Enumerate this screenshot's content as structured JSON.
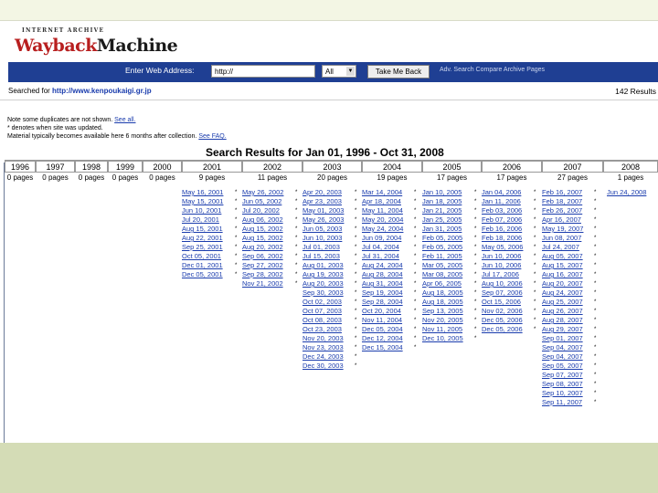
{
  "logo": {
    "top": "INTERNET ARCHIVE",
    "brand_a": "Wayback",
    "brand_b": "Machine"
  },
  "nav": {
    "enter_label": "Enter Web Address:",
    "url_value": "http://",
    "select_value": "All",
    "button_label": "Take Me Back",
    "links": "Adv. Search   Compare Archive Pages"
  },
  "searched": {
    "prefix": "Searched for",
    "url": "http://www.kenpoukaigi.gr.jp"
  },
  "results_count": "142 Results",
  "notes": [
    "Note some duplicates are not shown.",
    "See all.",
    "* denotes when site was updated.",
    "Material typically becomes available here 6 months after collection.",
    "See FAQ."
  ],
  "title": "Search Results for Jan 01, 1996 - Oct 31, 2008",
  "columns": [
    {
      "year": "1996",
      "pages": "0 pages",
      "dates": []
    },
    {
      "year": "1997",
      "pages": "0 pages",
      "dates": []
    },
    {
      "year": "1998",
      "pages": "0 pages",
      "dates": []
    },
    {
      "year": "1999",
      "pages": "0 pages",
      "dates": []
    },
    {
      "year": "2000",
      "pages": "0 pages",
      "dates": []
    },
    {
      "year": "2001",
      "pages": "9 pages",
      "dates": [
        "May 16, 2001",
        "May 15, 2001",
        "Jun 10, 2001",
        "Jul 20, 2001",
        "Aug 15, 2001",
        "Aug 22, 2001",
        "Sep 25, 2001",
        "Oct 05, 2001",
        "Dec 01, 2001",
        "Dec 05, 2001"
      ]
    },
    {
      "year": "2002",
      "pages": "11 pages",
      "dates": [
        "May 26, 2002",
        "Jun 05, 2002",
        "Jul 20, 2002",
        "Aug 06, 2002",
        "Aug 15, 2002",
        "Aug 15, 2002",
        "Aug 20, 2002",
        "Sep 06, 2002",
        "Sep 27, 2002",
        "Sep 28, 2002",
        "Nov 21, 2002"
      ]
    },
    {
      "year": "2003",
      "pages": "20 pages",
      "dates": [
        "Apr 20, 2003",
        "Apr 23, 2003",
        "May 01, 2003",
        "May 26, 2003",
        "Jun 05, 2003",
        "Jun 10, 2003",
        "Jul 01, 2003",
        "Jul 15, 2003",
        "Aug 01, 2003",
        "Aug 19, 2003",
        "Aug 20, 2003",
        "Sep 30, 2003",
        "Oct 02, 2003",
        "Oct 07, 2003",
        "Oct 08, 2003",
        "Oct 23, 2003",
        "Nov 20, 2003",
        "Nov 23, 2003",
        "Dec 24, 2003",
        "Dec 30, 2003"
      ]
    },
    {
      "year": "2004",
      "pages": "19 pages",
      "dates": [
        "Mar 14, 2004",
        "Apr 18, 2004",
        "May 11, 2004",
        "May 20, 2004",
        "May 24, 2004",
        "Jun 09, 2004",
        "Jul 04, 2004",
        "Jul 31, 2004",
        "Aug 24, 2004",
        "Aug 28, 2004",
        "Aug 31, 2004",
        "Sep 19, 2004",
        "Sep 28, 2004",
        "Oct 20, 2004",
        "Nov 11, 2004",
        "Dec 05, 2004",
        "Dec 12, 2004",
        "Dec 15, 2004"
      ]
    },
    {
      "year": "2005",
      "pages": "17 pages",
      "dates": [
        "Jan 10, 2005",
        "Jan 18, 2005",
        "Jan 21, 2005",
        "Jan 25, 2005",
        "Jan 31, 2005",
        "Feb 05, 2005",
        "Feb 05, 2005",
        "Feb 11, 2005",
        "Mar 05, 2005",
        "Mar 08, 2005",
        "Apr 06, 2005",
        "Aug 18, 2005",
        "Aug 18, 2005",
        "Sep 13, 2005",
        "Nov 20, 2005",
        "Nov 11, 2005",
        "Dec 10, 2005"
      ]
    },
    {
      "year": "2006",
      "pages": "17 pages",
      "dates": [
        "Jan 04, 2006",
        "Jan 11, 2006",
        "Feb 03, 2006",
        "Feb 07, 2006",
        "Feb 16, 2006",
        "Feb 18, 2006",
        "May 05, 2006",
        "Jun 10, 2006",
        "Jun 10, 2006",
        "Jul 17, 2006",
        "Aug 10, 2006",
        "Sep 07, 2006",
        "Oct 15, 2006",
        "Nov 02, 2006",
        "Dec 05, 2006",
        "Dec 05, 2006"
      ]
    },
    {
      "year": "2007",
      "pages": "27 pages",
      "dates": [
        "Feb 16, 2007",
        "Feb 18, 2007",
        "Feb 26, 2007",
        "Apr 16, 2007",
        "May 19, 2007",
        "Jun 08, 2007",
        "Jul 24, 2007",
        "Aug 05, 2007",
        "Aug 15, 2007",
        "Aug 16, 2007",
        "Aug 20, 2007",
        "Aug 24, 2007",
        "Aug 25, 2007",
        "Aug 26, 2007",
        "Aug 28, 2007",
        "Aug 29, 2007",
        "Sep 01, 2007",
        "Sep 04, 2007",
        "Sep 04, 2007",
        "Sep 05, 2007",
        "Sep 07, 2007",
        "Sep 08, 2007",
        "Sep 10, 2007",
        "Sep 11, 2007"
      ]
    },
    {
      "year": "2008",
      "pages": "1 pages",
      "dates": [
        "Jun 24, 2008"
      ]
    }
  ]
}
